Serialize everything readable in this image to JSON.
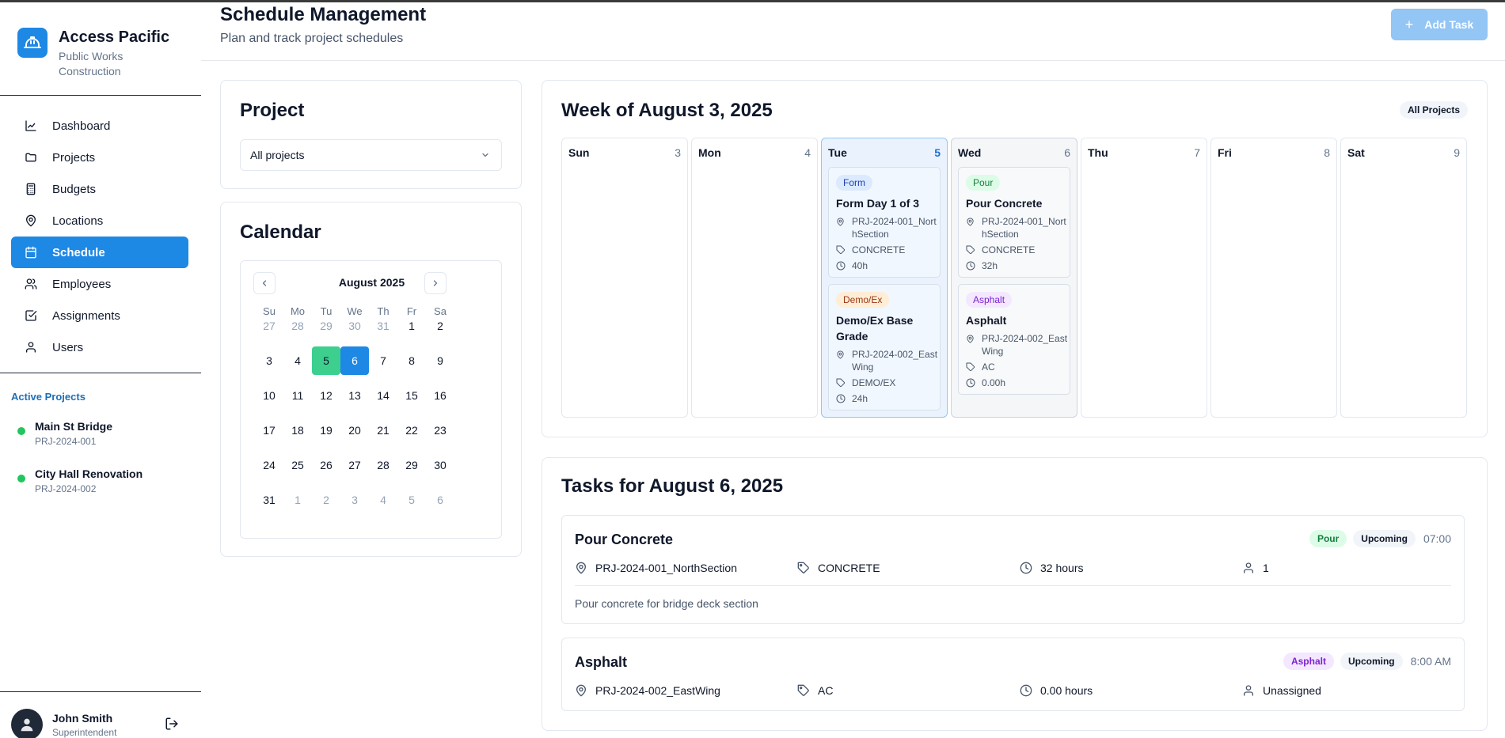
{
  "app": {
    "name": "Access Pacific",
    "subtitle": "Public Works Construction"
  },
  "nav": [
    {
      "label": "Dashboard",
      "icon": "chart-line-icon"
    },
    {
      "label": "Projects",
      "icon": "folder-icon"
    },
    {
      "label": "Budgets",
      "icon": "calculator-icon"
    },
    {
      "label": "Locations",
      "icon": "map-pin-icon"
    },
    {
      "label": "Schedule",
      "icon": "calendar-icon",
      "active": true
    },
    {
      "label": "Employees",
      "icon": "users-icon"
    },
    {
      "label": "Assignments",
      "icon": "check-square-icon"
    },
    {
      "label": "Users",
      "icon": "user-icon"
    }
  ],
  "active_projects": {
    "title": "Active Projects",
    "items": [
      {
        "name": "Main St Bridge",
        "code": "PRJ-2024-001"
      },
      {
        "name": "City Hall Renovation",
        "code": "PRJ-2024-002"
      }
    ]
  },
  "user": {
    "name": "John Smith",
    "role": "Superintendent"
  },
  "header": {
    "title": "Schedule Management",
    "subtitle": "Plan and track project schedules",
    "add_task": "Add Task"
  },
  "project_card": {
    "title": "Project",
    "select_value": "All projects"
  },
  "calendar_card": {
    "title": "Calendar",
    "month": "August 2025",
    "dow": [
      "Su",
      "Mo",
      "Tu",
      "We",
      "Th",
      "Fr",
      "Sa"
    ],
    "weeks": [
      [
        "27",
        "28",
        "29",
        "30",
        "31",
        "1",
        "2"
      ],
      [
        "3",
        "4",
        "5",
        "6",
        "7",
        "8",
        "9"
      ],
      [
        "10",
        "11",
        "12",
        "13",
        "14",
        "15",
        "16"
      ],
      [
        "17",
        "18",
        "19",
        "20",
        "21",
        "22",
        "23"
      ],
      [
        "24",
        "25",
        "26",
        "27",
        "28",
        "29",
        "30"
      ],
      [
        "31",
        "1",
        "2",
        "3",
        "4",
        "5",
        "6"
      ]
    ],
    "today": "5",
    "selected": "6"
  },
  "week": {
    "title": "Week of August 3, 2025",
    "filter": "All Projects",
    "days": [
      {
        "name": "Sun",
        "num": "3"
      },
      {
        "name": "Mon",
        "num": "4"
      },
      {
        "name": "Tue",
        "num": "5"
      },
      {
        "name": "Wed",
        "num": "6"
      },
      {
        "name": "Thu",
        "num": "7"
      },
      {
        "name": "Fri",
        "num": "8"
      },
      {
        "name": "Sat",
        "num": "9"
      }
    ],
    "events": {
      "tue": [
        {
          "tag": "Form",
          "title": "Form Day 1 of 3",
          "location": "PRJ-2024-001_NorthSection",
          "code": "CONCRETE",
          "hours": "40h"
        },
        {
          "tag": "Demo/Ex",
          "title": "Demo/Ex Base Grade",
          "location": "PRJ-2024-002_EastWing",
          "code": "DEMO/EX",
          "hours": "24h"
        }
      ],
      "wed": [
        {
          "tag": "Pour",
          "title": "Pour Concrete",
          "location": "PRJ-2024-001_NorthSection",
          "code": "CONCRETE",
          "hours": "32h"
        },
        {
          "tag": "Asphalt",
          "title": "Asphalt",
          "location": "PRJ-2024-002_EastWing",
          "code": "AC",
          "hours": "0.00h"
        }
      ]
    }
  },
  "tasks": {
    "title": "Tasks for August 6, 2025",
    "items": [
      {
        "name": "Pour Concrete",
        "tag": "Pour",
        "status": "Upcoming",
        "time": "07:00",
        "location": "PRJ-2024-001_NorthSection",
        "code": "CONCRETE",
        "hours": "32 hours",
        "assigned": "1",
        "description": "Pour concrete for bridge deck section"
      },
      {
        "name": "Asphalt",
        "tag": "Asphalt",
        "status": "Upcoming",
        "time": "8:00 AM",
        "location": "PRJ-2024-002_EastWing",
        "code": "AC",
        "hours": "0.00 hours",
        "assigned": "Unassigned"
      }
    ]
  },
  "colors": {
    "primary": "#1e88e5",
    "today": "#3ccf8e",
    "active_dot": "#22c55e"
  }
}
